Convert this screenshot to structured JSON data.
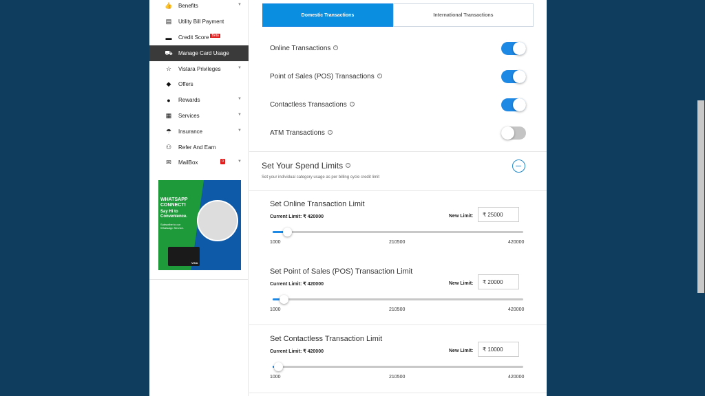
{
  "sidebar": {
    "items": [
      {
        "label": "Benefits",
        "icon": "thumbs-up-icon",
        "glyph": "👍",
        "chevron": true
      },
      {
        "label": "Utility Bill Payment",
        "icon": "bill-icon",
        "glyph": "▤",
        "chevron": false
      },
      {
        "label": "Credit Score",
        "icon": "card-icon",
        "glyph": "▬",
        "chevron": false,
        "badge": "Beta"
      },
      {
        "label": "Manage Card Usage",
        "icon": "truck-icon",
        "glyph": "⛟",
        "chevron": false,
        "active": true
      },
      {
        "label": "Vistara Privileges",
        "icon": "star-icon",
        "glyph": "☆",
        "chevron": true
      },
      {
        "label": "Offers",
        "icon": "tag-icon",
        "glyph": "◆",
        "chevron": false
      },
      {
        "label": "Rewards",
        "icon": "medal-icon",
        "glyph": "●",
        "chevron": true
      },
      {
        "label": "Services",
        "icon": "services-icon",
        "glyph": "▦",
        "chevron": true
      },
      {
        "label": "Insurance",
        "icon": "umbrella-icon",
        "glyph": "☂",
        "chevron": true
      },
      {
        "label": "Refer And Earn",
        "icon": "users-icon",
        "glyph": "⚇",
        "chevron": false
      },
      {
        "label": "MailBox",
        "icon": "mail-icon",
        "glyph": "✉",
        "chevron": true,
        "count": "0"
      }
    ],
    "banner": {
      "title": "WHATSAPP CONNECT!",
      "subtitle": "Say Hi to Convenience.",
      "body": "Subscribe to our WhatsApp Service.",
      "card_brand": "VISA"
    }
  },
  "tabs": {
    "domestic": "Domestic Transactions",
    "international": "International Transactions"
  },
  "toggles": [
    {
      "label": "Online Transactions",
      "on": true
    },
    {
      "label": "Point of Sales (POS) Transactions",
      "on": true
    },
    {
      "label": "Contactless Transactions",
      "on": true
    },
    {
      "label": "ATM Transactions",
      "on": false
    }
  ],
  "spend": {
    "title": "Set Your Spend Limits",
    "subtitle": "Set your individual category usage as per billing cycle credit limit"
  },
  "limits": [
    {
      "title": "Set Online Transaction Limit",
      "current": "Current Limit: ₹ 420000",
      "new_label": "New Limit:",
      "value": "25000",
      "min": "1000",
      "mid": "210500",
      "max": "420000",
      "fraction": 0.057
    },
    {
      "title": "Set Point of Sales (POS) Transaction Limit",
      "current": "Current Limit: ₹ 420000",
      "new_label": "New Limit:",
      "value": "20000",
      "min": "1000",
      "mid": "210500",
      "max": "420000",
      "fraction": 0.045
    },
    {
      "title": "Set Contactless Transaction Limit",
      "current": "Current Limit: ₹ 420000",
      "new_label": "New Limit:",
      "value": "10000",
      "min": "1000",
      "mid": "210500",
      "max": "420000",
      "fraction": 0.021
    }
  ],
  "currency_symbol": "₹",
  "info_glyph": "i",
  "colors": {
    "accent": "#1e88e5",
    "background": "#0f3d5e",
    "active_nav": "#3a3a3a"
  }
}
